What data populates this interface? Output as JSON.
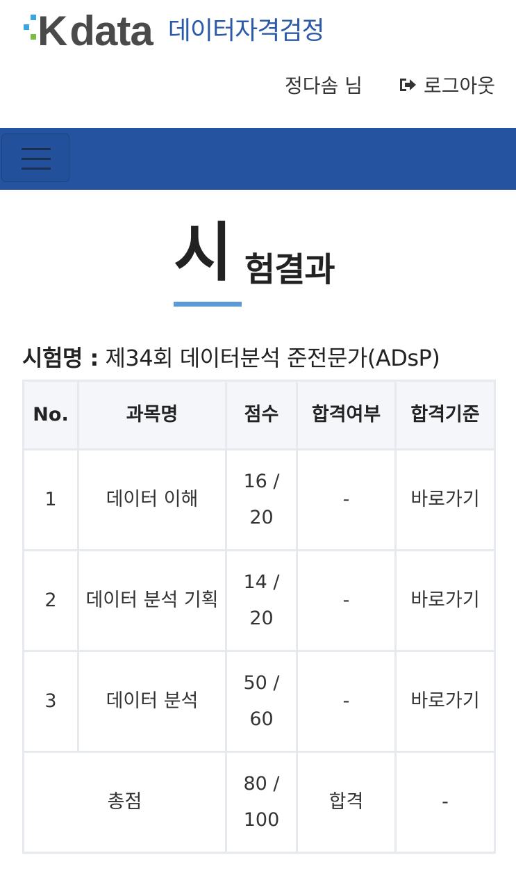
{
  "header": {
    "logo_k": "K",
    "logo_data": "data",
    "logo_subtitle": "데이터자격검정",
    "user_name": "정다솜 님",
    "logout_label": "로그아웃"
  },
  "page_title": {
    "first_char": "시",
    "rest": "험결과"
  },
  "exam": {
    "label": "시험명 :",
    "name": "제34회 데이터분석 준전문가(ADsP)"
  },
  "table": {
    "headers": [
      "No.",
      "과목명",
      "점수",
      "합격여부",
      "합격기준"
    ],
    "rows": [
      {
        "no": "1",
        "subject": "데이터 이해",
        "score": "16 / 20",
        "pass": "-",
        "criteria": "바로가기"
      },
      {
        "no": "2",
        "subject": "데이터 분석 기획",
        "score": "14 / 20",
        "pass": "-",
        "criteria": "바로가기"
      },
      {
        "no": "3",
        "subject": "데이터 분석",
        "score": "50 / 60",
        "pass": "-",
        "criteria": "바로가기"
      }
    ],
    "total": {
      "label": "총점",
      "score": "80 / 100",
      "pass": "합격",
      "criteria": "-"
    }
  },
  "colors": {
    "navbar": "#2553a0",
    "logo_subtitle": "#2a5aa8",
    "title_underline": "#5b9bd5",
    "logo_blue": "#3aa6dd",
    "logo_green": "#7dbb42"
  },
  "icons": [
    "menu-icon",
    "logout-icon"
  ]
}
